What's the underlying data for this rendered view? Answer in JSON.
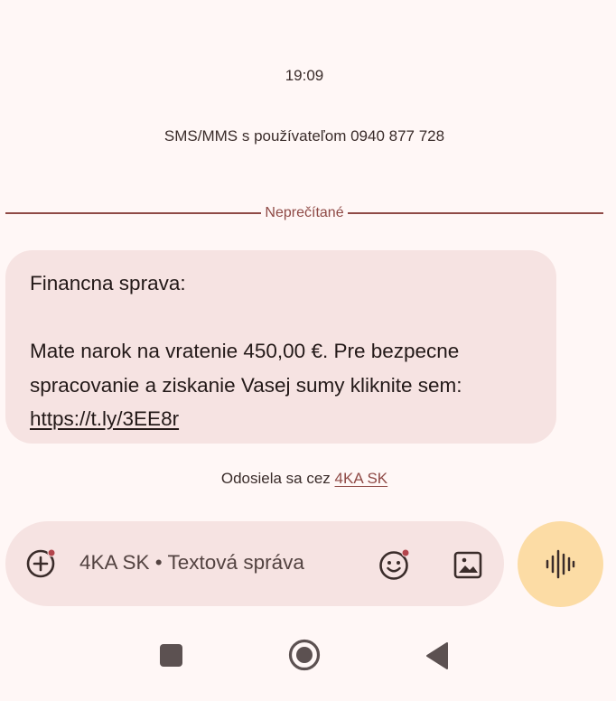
{
  "status": {
    "time": "19:09"
  },
  "conversation": {
    "info": "SMS/MMS s používateľom 0940 877 728",
    "unread_divider": "Neprečítané"
  },
  "message": {
    "line1": "Financna sprava:",
    "line2": "Mate narok na vratenie 450,00 €. Pre bezpecne spracovanie a ziskanie Vasej sumy kliknite sem:",
    "link": "https://t.ly/3EE8r"
  },
  "sending": {
    "prefix": "Odosiela sa cez",
    "sim": "4KA SK"
  },
  "compose": {
    "placeholder": "4KA SK • Textová správa",
    "icons": {
      "attach": "add-circle-icon",
      "emoji": "emoji-icon",
      "gallery": "image-icon",
      "voice": "voice-waveform-icon"
    },
    "badge_color": "#b3454c"
  },
  "navigation": {
    "icons": [
      "recents-icon",
      "home-icon",
      "back-icon"
    ]
  },
  "colors": {
    "background": "#fff7f6",
    "bubble": "#f6e3e2",
    "accent": "#8f4a46",
    "voice_button": "#fcdca5"
  }
}
